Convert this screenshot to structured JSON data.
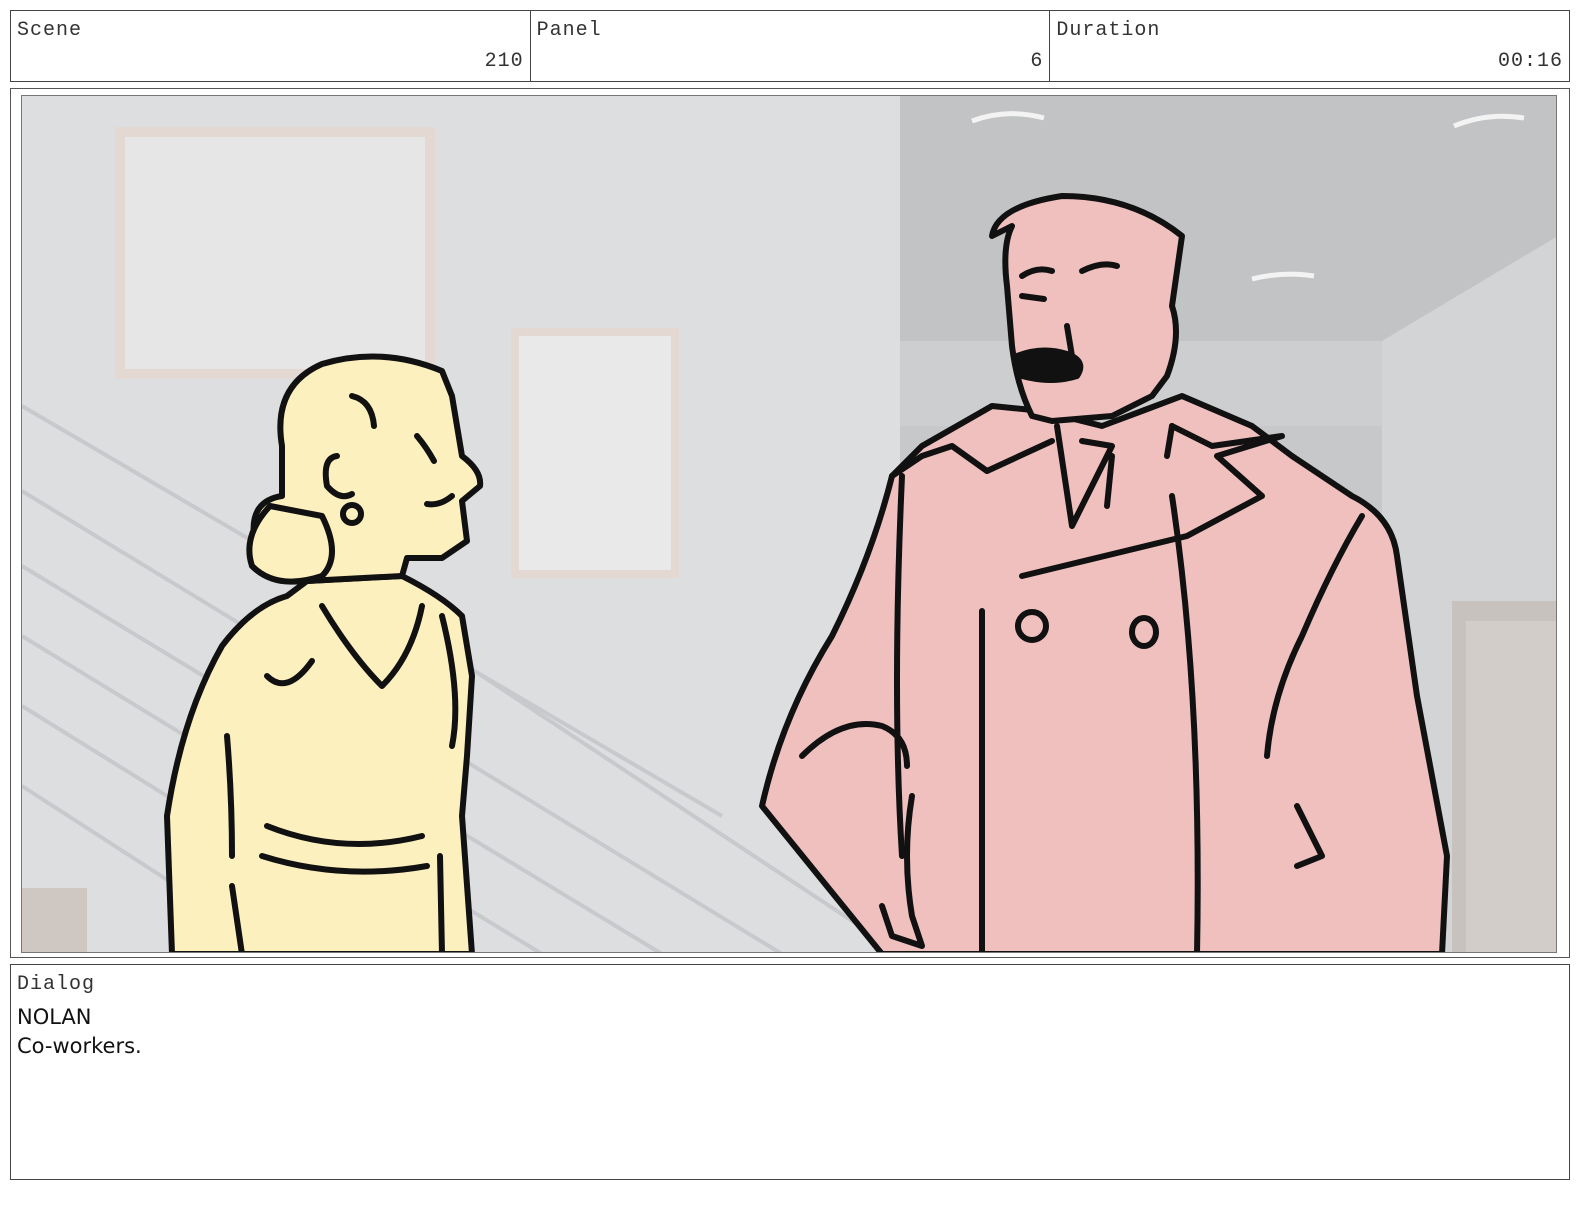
{
  "header": {
    "scene_label": "Scene",
    "scene_value": "210",
    "panel_label": "Panel",
    "panel_value": "6",
    "duration_label": "Duration",
    "duration_value": "00:16"
  },
  "dialog": {
    "label": "Dialog",
    "speaker": "NOLAN",
    "line": "Co-workers."
  },
  "colors": {
    "woman_fill": "#fdf0bf",
    "man_fill": "#efc0be",
    "wall_left": "#dddee0",
    "wall_right": "#c6c7c8",
    "frame_border": "#444444"
  }
}
